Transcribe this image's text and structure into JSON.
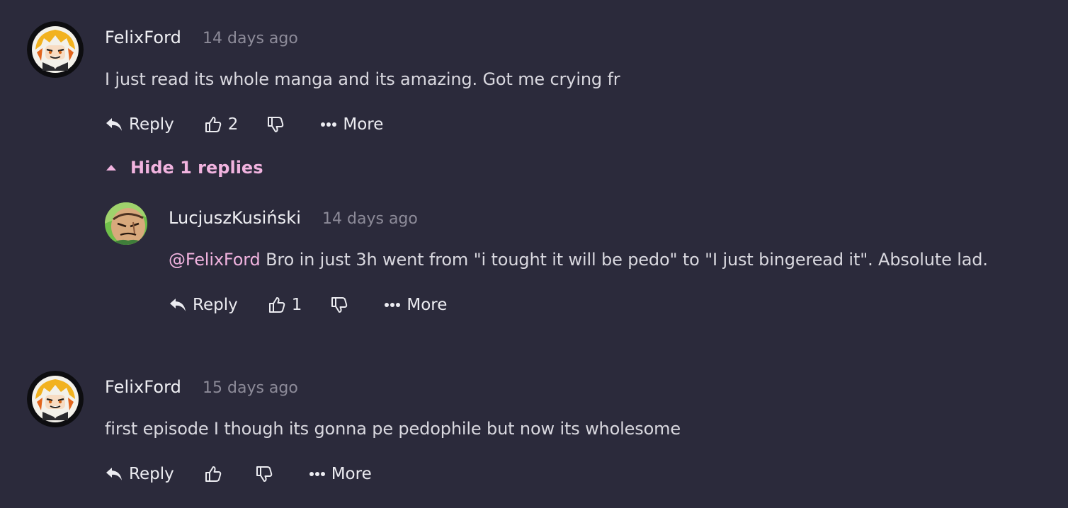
{
  "comments": [
    {
      "username": "FelixFord",
      "time": "14 days ago",
      "text": "I just read its whole manga and its amazing. Got me crying fr",
      "reply_label": "Reply",
      "likes": "2",
      "more_label": "More",
      "hide_replies_label": "Hide 1 replies",
      "replies": [
        {
          "username": "LucjuszKusiński",
          "time": "14 days ago",
          "mention": "@FelixFord",
          "text": " Bro in just 3h went from \"i tought it will be pedo\" to \"I just bingeread it\". Absolute lad.",
          "reply_label": "Reply",
          "likes": "1",
          "more_label": "More"
        }
      ]
    },
    {
      "username": "FelixFord",
      "time": "15 days ago",
      "text": "first episode I though its gonna pe pedophile but now its wholesome",
      "reply_label": "Reply",
      "likes": "",
      "more_label": "More"
    }
  ],
  "icons": {
    "reply": "reply-arrow-icon",
    "like": "thumbs-up-icon",
    "dislike": "thumbs-down-icon",
    "more": "ellipsis-icon",
    "collapse": "caret-up-icon"
  },
  "colors": {
    "background": "#2b2a3b",
    "accent": "#f1b3df",
    "muted": "#8d8b99",
    "text": "#d9d8df"
  }
}
